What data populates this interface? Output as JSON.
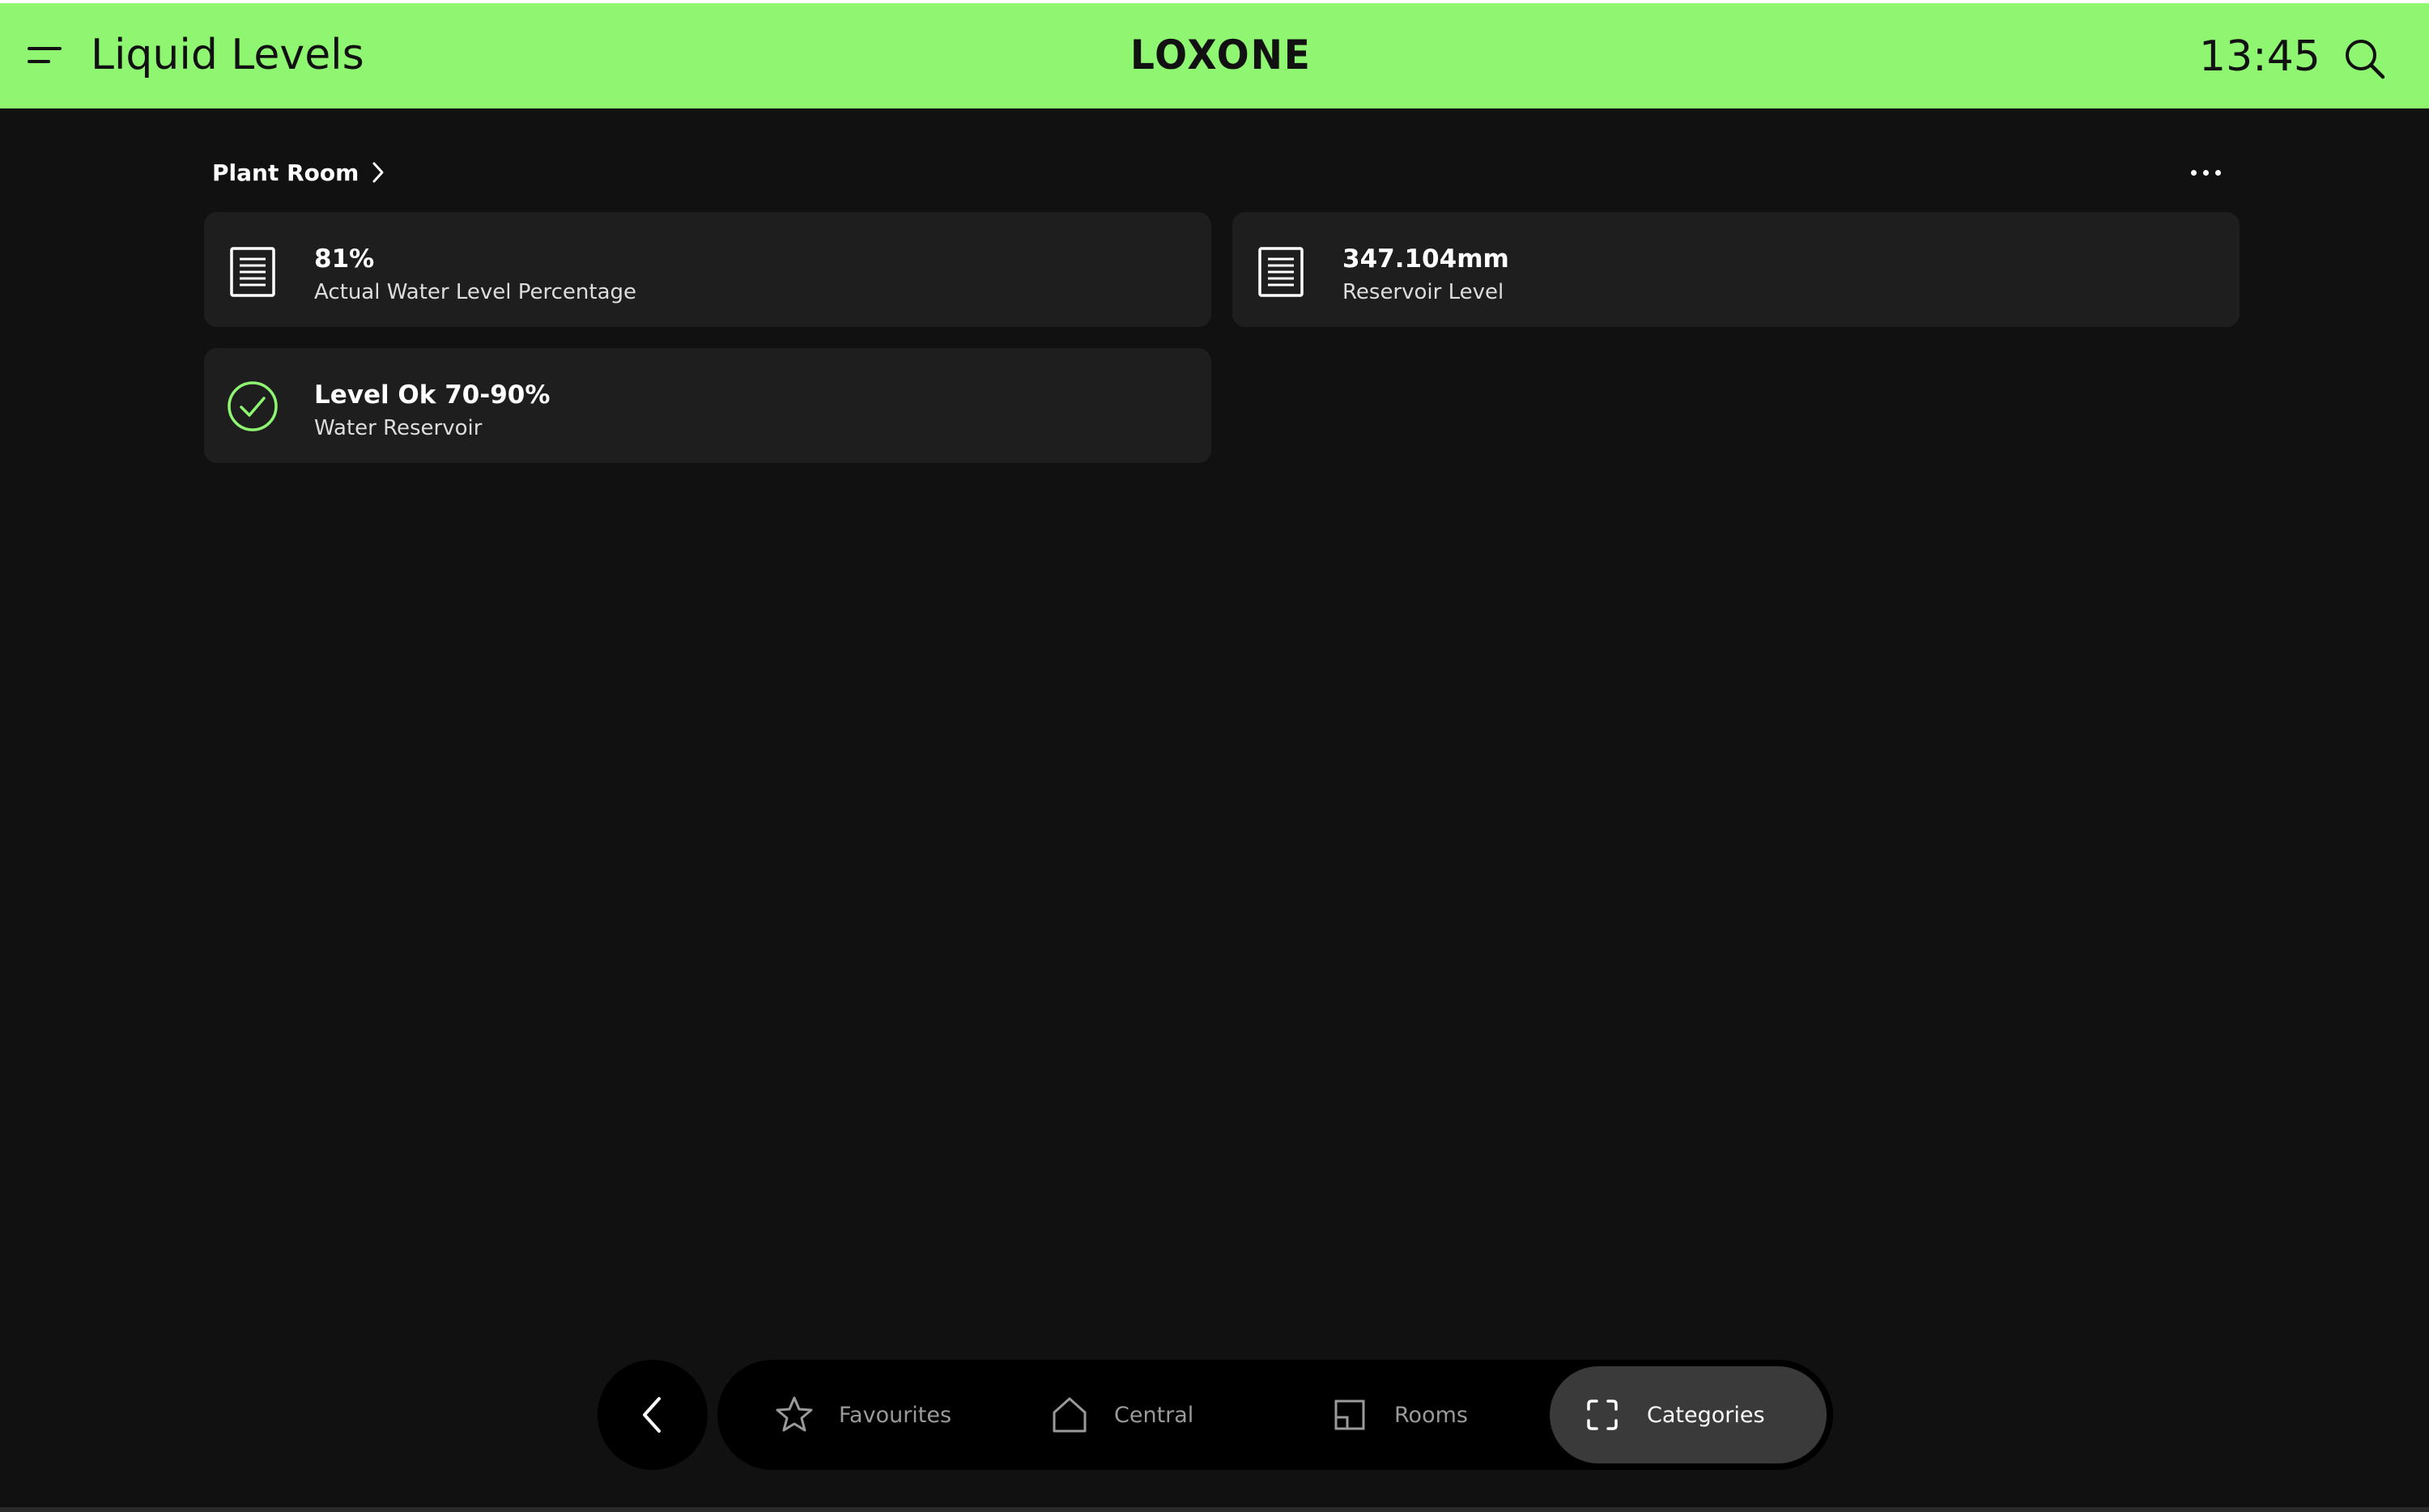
{
  "header": {
    "title": "Liquid Levels",
    "logo": "LOXONE",
    "time": "13:45",
    "menu_icon": "hamburger-menu-icon",
    "search_icon": "search-icon"
  },
  "breadcrumb": {
    "label": "Plant Room",
    "chevron_icon": "chevron-right-icon"
  },
  "more_icon": "more-options-icon",
  "cards": [
    {
      "value": "81%",
      "label": "Actual Water Level Percentage",
      "icon": "document-lines-icon"
    },
    {
      "value": "347.104mm",
      "label": "Reservoir Level",
      "icon": "document-lines-icon"
    },
    {
      "value": "Level Ok 70-90%",
      "label": "Water Reservoir",
      "icon": "check-circle-icon",
      "icon_color": "#8ff672"
    }
  ],
  "nav": {
    "back_icon": "chevron-left-icon",
    "tabs": [
      {
        "label": "Favourites",
        "icon": "star-icon",
        "active": false
      },
      {
        "label": "Central",
        "icon": "home-icon",
        "active": false
      },
      {
        "label": "Rooms",
        "icon": "floorplan-icon",
        "active": false
      },
      {
        "label": "Categories",
        "icon": "categories-icon",
        "active": true
      }
    ]
  },
  "colors": {
    "accent": "#8ff672",
    "background": "#111111",
    "card": "#1e1e1e",
    "active_tab": "#3a3a3a"
  }
}
